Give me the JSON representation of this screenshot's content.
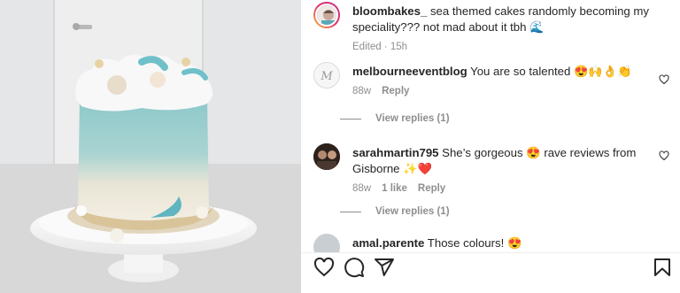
{
  "post": {
    "author": "bloombakes_",
    "caption": " sea themed cakes randomly becoming my speciality??? not mad about it tbh 🌊",
    "edited_label": "Edited · 15h"
  },
  "comments": [
    {
      "username": "melbourneeventblog",
      "text": " You are so talented 😍🙌👌👏",
      "age": "88w",
      "likes": "",
      "reply_label": "Reply",
      "view_replies": "View replies (1)"
    },
    {
      "username": "sarahmartin795",
      "text": " She’s gorgeous 😍 rave reviews from Gisborne ✨❤️",
      "age": "88w",
      "likes": "1 like",
      "reply_label": "Reply",
      "view_replies": "View replies (1)"
    },
    {
      "username": "amal.parente",
      "text": " Those colours! 😍"
    }
  ],
  "actions": {
    "like_icon": "heart-icon",
    "comment_icon": "comment-icon",
    "share_icon": "send-icon",
    "save_icon": "bookmark-icon"
  },
  "colors": {
    "cake_teal": "#8fc9cb",
    "cake_cream": "#f2ecdf",
    "text_secondary": "#8e8e8e"
  }
}
